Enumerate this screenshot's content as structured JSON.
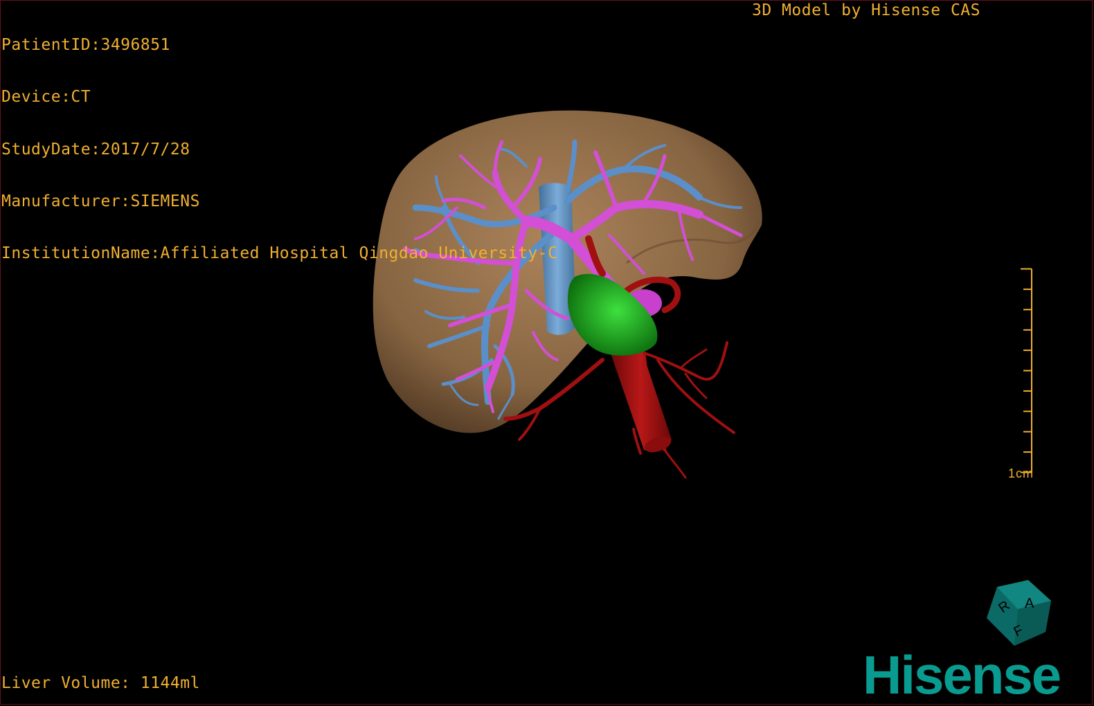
{
  "info": {
    "patient_id": "PatientID:3496851",
    "device": "Device:CT",
    "study_date": "StudyDate:2017/7/28",
    "manufacturer": "Manufacturer:SIEMENS",
    "institution": "InstitutionName:Affiliated Hospital Qingdao University-C"
  },
  "brand_title": "3D Model by Hisense CAS",
  "scale_bar": {
    "label": "1cm",
    "ticks": 10
  },
  "liver_volume": "Liver Volume: 1144ml",
  "orientation_cube": {
    "faces": [
      "R",
      "A",
      "F"
    ]
  },
  "logo_text": "Hisense",
  "colors": {
    "overlay_text": "#f0b030",
    "liver": "#a07a52",
    "portal_vein": "#d24fd6",
    "hepatic_vein": "#5b8fc9",
    "artery": "#a01010",
    "tumor": "#1ea61e",
    "brand": "#0a9b90"
  }
}
